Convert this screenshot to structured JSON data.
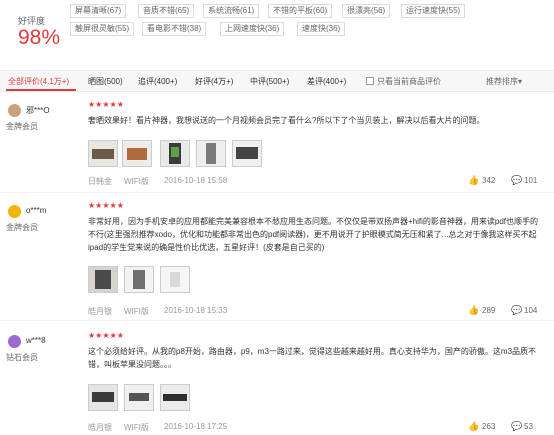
{
  "summary": {
    "rate_label": "好评度",
    "rate_value": "98%"
  },
  "tags": [
    "屏幕清晰(67)",
    "音质不错(65)",
    "系统流畅(61)",
    "不错的平板(60)",
    "很漂亮(56)",
    "运行速度快(55)",
    "触屏很灵敏(55)",
    "看电影不错(38)",
    "上网速度快(36)",
    "速度快(36)"
  ],
  "filters": {
    "all": "全部评价(4.1万+)",
    "pics": "晒图(500)",
    "append": "追评(400+)",
    "good": "好评(4万+)",
    "mid": "中评(500+)",
    "bad": "差评(400+)",
    "current_only": "只看当前商品评价",
    "sort": "推荐排序",
    "sort_arrow": "▾"
  },
  "reviews": [
    {
      "user": "邪***O",
      "level": "金牌会员",
      "stars": "★★★★★",
      "text": "奢晒效果好！看片神器，我想说送的一个月视频会员完了看什么?所以下了个当贝装上，解决以后看大片的问题。",
      "device": "日韩金",
      "net": "WIFI版",
      "date": "2016-10-18 15:58",
      "likes": "342",
      "comments": "101",
      "avatar_color": "#c8a27a"
    },
    {
      "user": "o***m",
      "level": "金牌会员",
      "stars": "★★★★★",
      "text": "非常好用，因为手机安卓的应用都能完美兼容根本不愁应用生态问题。不仅仅是带双扬声器+hifi的影音神器，用来读pdf也顺手的不行(这里强烈推荐xodo，优化和功能都非常出色的pdf阅读器)，更不用说开了护眼模式简无压和紧了...总之对于像我这样买不起ipad的学生党来说的确是性价比优选，五星好评！(皮套是自己买的)",
      "device": "皓月银",
      "net": "WIFI版",
      "date": "2016-10-18 15:33",
      "likes": "289",
      "comments": "104",
      "avatar_color": "#f2b400"
    },
    {
      "user": "w***8",
      "level": "钻石会员",
      "stars": "★★★★★",
      "text": "这个必须给好评。从我的p8开始，路由器，p9，m3一路过来，觉得这些越来越好用。真心支持华为，国产的骄傲。这m3品质不错，叫板苹果没问题。。。",
      "device": "皓月银",
      "net": "WIFI版",
      "date": "2016-10-18 17:25",
      "likes": "263",
      "comments": "53",
      "avatar_color": "#9b6bd1"
    }
  ],
  "colors": {
    "accent": "#e4393c",
    "border": "#eeeeee",
    "muted": "#999999"
  },
  "icons": {
    "like": "thumbs-up-icon",
    "comment": "comment-icon"
  }
}
